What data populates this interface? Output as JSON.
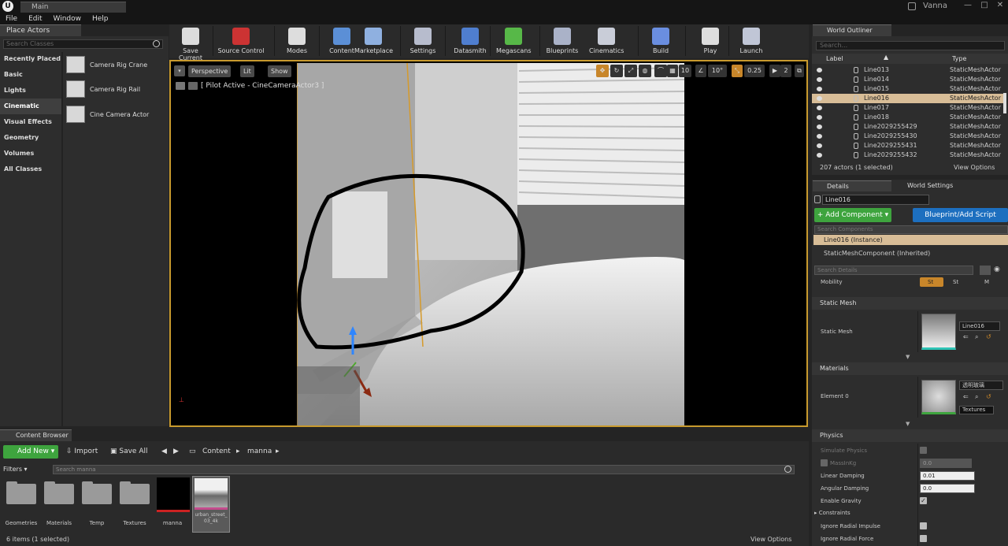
{
  "titlebar": {
    "tab": "Main",
    "user": "Vanna"
  },
  "menu": [
    "File",
    "Edit",
    "Window",
    "Help"
  ],
  "place_actors": {
    "tab": "Place Actors",
    "search_placeholder": "Search Classes",
    "categories": [
      "Recently Placed",
      "Basic",
      "Lights",
      "Cinematic",
      "Visual Effects",
      "Geometry",
      "Volumes",
      "All Classes"
    ],
    "selected_category": "Cinematic",
    "actors": [
      "Camera Rig Crane",
      "Camera Rig Rail",
      "Cine Camera Actor"
    ]
  },
  "toolbar": [
    {
      "label": "Save Current",
      "icon": "save-icon",
      "color": "#dcdcdc"
    },
    {
      "label": "Source Control",
      "icon": "source-control-icon",
      "color": "#cc3333"
    },
    {
      "label": "Modes",
      "icon": "modes-icon",
      "color": "#dddddd"
    },
    {
      "label": "Content",
      "icon": "content-icon",
      "color": "#5b8fd6"
    },
    {
      "label": "Marketplace",
      "icon": "marketplace-icon",
      "color": "#8fb0e0"
    },
    {
      "label": "Settings",
      "icon": "settings-icon",
      "color": "#b7bccd"
    },
    {
      "label": "Datasmith",
      "icon": "datasmith-icon",
      "color": "#4f7ecf"
    },
    {
      "label": "Megascans",
      "icon": "megascans-icon",
      "color": "#57b848"
    },
    {
      "label": "Blueprints",
      "icon": "blueprints-icon",
      "color": "#aab2c8"
    },
    {
      "label": "Cinematics",
      "icon": "cinematics-icon",
      "color": "#c9cdd8"
    },
    {
      "label": "Build",
      "icon": "build-icon",
      "color": "#6a8ee0"
    },
    {
      "label": "Play",
      "icon": "play-icon",
      "color": "#dddddd"
    },
    {
      "label": "Launch",
      "icon": "launch-icon",
      "color": "#c0c6d6"
    }
  ],
  "viewport": {
    "perspective": "Perspective",
    "lit": "Lit",
    "show": "Show",
    "pilot": "[ Pilot Active - CineCameraActor3 ]",
    "grid_snap": "10",
    "rot_snap": "10°",
    "scale_snap": "0.25",
    "cam_speed": "2"
  },
  "world_outliner": {
    "tab": "World Outliner",
    "search_placeholder": "Search...",
    "col_label": "Label",
    "col_type": "Type",
    "rows": [
      {
        "label": "Line013",
        "type": "StaticMeshActor"
      },
      {
        "label": "Line014",
        "type": "StaticMeshActor"
      },
      {
        "label": "Line015",
        "type": "StaticMeshActor"
      },
      {
        "label": "Line016",
        "type": "StaticMeshActor",
        "selected": true
      },
      {
        "label": "Line017",
        "type": "StaticMeshActor"
      },
      {
        "label": "Line018",
        "type": "StaticMeshActor"
      },
      {
        "label": "Line2029255429",
        "type": "StaticMeshActor"
      },
      {
        "label": "Line2029255430",
        "type": "StaticMeshActor"
      },
      {
        "label": "Line2029255431",
        "type": "StaticMeshActor"
      },
      {
        "label": "Line2029255432",
        "type": "StaticMeshActor"
      }
    ],
    "count": "207 actors (1 selected)",
    "view_options": "View Options"
  },
  "details": {
    "tab": "Details",
    "tab2": "World Settings",
    "name": "Line016",
    "add_component": "+ Add Component ▾",
    "blueprint_script": "Blueprint/Add Script",
    "search_components": "Search Components",
    "instance": "Line016 (Instance)",
    "component": "StaticMeshComponent (Inherited)",
    "search_details": "Search Details",
    "mobility": "Mobility",
    "mobility_opts": [
      "St",
      "St",
      "M"
    ],
    "static_mesh_section": "Static Mesh",
    "static_mesh_label": "Static Mesh",
    "static_mesh_value": "Line016",
    "materials_section": "Materials",
    "element0": "Element 0",
    "material_value": "透明玻璃",
    "textures": "Textures",
    "physics_section": "Physics",
    "simulate_physics": "Simulate Physics",
    "mass": "MassInKg",
    "mass_value": "0.0",
    "linear_damping": "Linear Damping",
    "linear_value": "0.01",
    "angular_damping": "Angular Damping",
    "angular_value": "0.0",
    "enable_gravity": "Enable Gravity",
    "constraints": "Constraints",
    "ignore_impulse": "Ignore Radial Impulse",
    "ignore_force": "Ignore Radial Force"
  },
  "content_browser": {
    "tab": "Content Browser",
    "add_new": "Add New ▾",
    "import": "Import",
    "save_all": "Save All",
    "path": [
      "Content",
      "manna"
    ],
    "filters": "Filters ▾",
    "search_placeholder": "Search manna",
    "folders": [
      "Geometries",
      "Materials",
      "Temp",
      "Textures"
    ],
    "assets": [
      "manna",
      "urban_street_03_4k"
    ],
    "count": "6 items (1 selected)",
    "view_options": "View Options"
  }
}
